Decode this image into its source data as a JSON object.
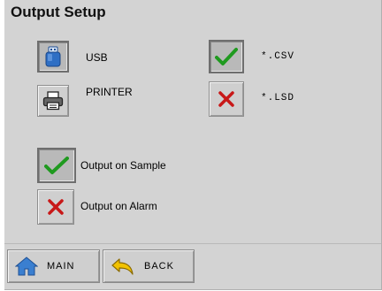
{
  "title": "Output Setup",
  "devices": {
    "usb": {
      "label": "USB",
      "icon": "usb-drive-icon"
    },
    "printer": {
      "label": "PRINTER",
      "icon": "printer-icon"
    }
  },
  "formats": {
    "csv": {
      "label": "*.CSV",
      "state": "enabled",
      "icon": "checkmark-icon"
    },
    "lsd": {
      "label": "*.LSD",
      "state": "disabled",
      "icon": "x-mark-icon"
    }
  },
  "options": {
    "sample": {
      "label": "Output on Sample",
      "state": "enabled",
      "icon": "checkmark-icon"
    },
    "alarm": {
      "label": "Output on Alarm",
      "state": "disabled",
      "icon": "x-mark-icon"
    }
  },
  "nav": {
    "main": {
      "label": "MAIN",
      "icon": "home-icon"
    },
    "back": {
      "label": "BACK",
      "icon": "back-arrow-icon"
    }
  },
  "colors": {
    "check": "#1f9a1f",
    "cross": "#c81818",
    "usb_blue": "#2f6fc4",
    "home_blue": "#3a7fd0",
    "back_yellow": "#f2c200"
  }
}
